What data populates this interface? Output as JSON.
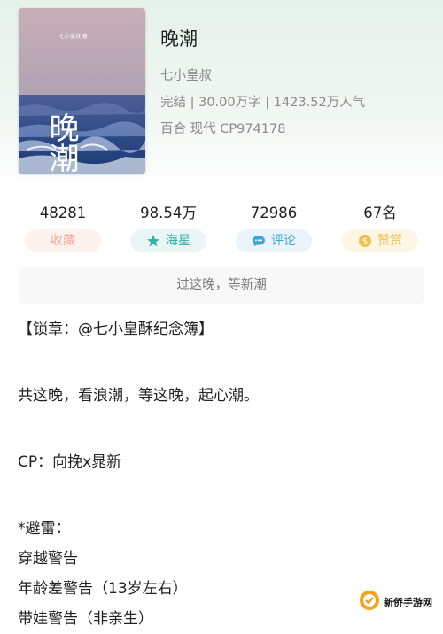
{
  "book": {
    "title": "晚潮",
    "author": "七小皇叔",
    "status_line": "完结 | 30.00万字 | 1423.52万人气",
    "tags_line": "百合  现代  CP974178",
    "cover": {
      "text_top": "七小皇叔 著",
      "text_main": "晚潮"
    }
  },
  "stats": [
    {
      "value": "48281",
      "label": "收藏",
      "icon": "heart-icon",
      "color": "#f2a996",
      "bg": "#fdf2ee"
    },
    {
      "value": "98.54万",
      "label": "海星",
      "icon": "star-icon",
      "color": "#36b0a7",
      "bg": "#eaf6f5"
    },
    {
      "value": "72986",
      "label": "评论",
      "icon": "comment-icon",
      "color": "#3aa7d9",
      "bg": "#eaf4fa"
    },
    {
      "value": "67名",
      "label": "赞赏",
      "icon": "coin-icon",
      "color": "#efc04d",
      "bg": "#fdf6e4"
    }
  ],
  "notice": "过这晚，等新潮",
  "content": [
    "【锁章：@七小皇酥纪念簿】",
    "共这晚，看浪潮，等这晚，起心潮。",
    "CP：向挽x晁新",
    "*避雷：",
    "穿越警告",
    "年龄差警告（13岁左右）",
    "带娃警告（非亲生）"
  ],
  "watermark": {
    "text": "新侨手游网"
  }
}
